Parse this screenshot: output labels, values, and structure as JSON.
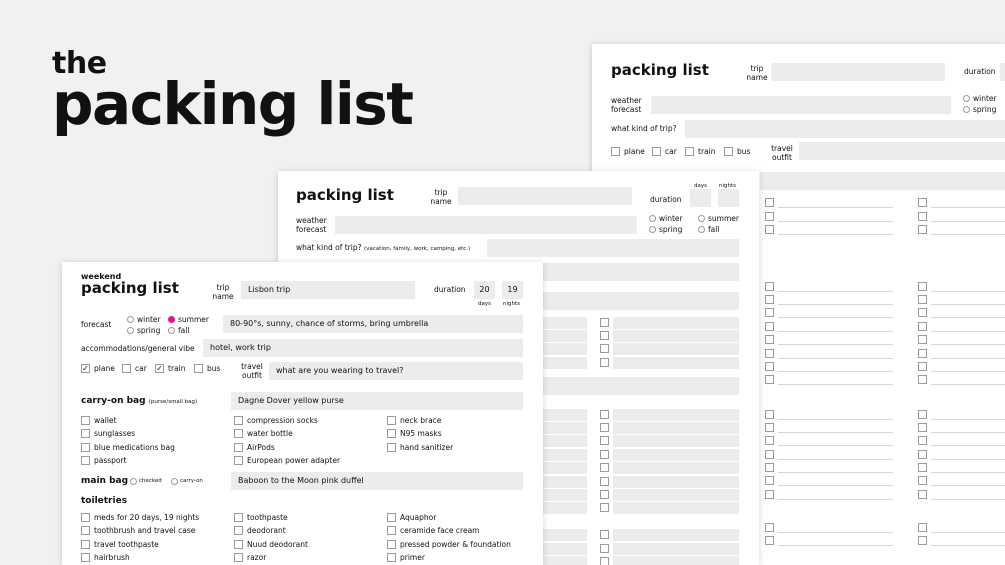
{
  "hero": {
    "top": "the",
    "title": "packing list"
  },
  "back_sheet": {
    "title": "packing list",
    "trip_name_label": "trip name",
    "duration_label": "duration",
    "weather_label": "weather forecast",
    "seasons": [
      "winter",
      "spring"
    ],
    "trip_kind_label": "what kind of trip?",
    "transport": [
      "plane",
      "car",
      "train",
      "bus"
    ],
    "travel_outfit_label": "travel outfit"
  },
  "middle_sheet": {
    "title": "packing list",
    "trip_name_label": "trip name",
    "duration_label": "duration",
    "days_label": "days",
    "nights_label": "nights",
    "weather_label": "weather forecast",
    "seasons": [
      "winter",
      "summer",
      "spring",
      "fall"
    ],
    "trip_kind_label": "what kind of trip?",
    "trip_kind_hint": "(vacation, family, work, camping, etc.)"
  },
  "front_sheet": {
    "subtitle": "weekend",
    "title": "packing list",
    "trip_name_label": "trip name",
    "trip_name_value": "Lisbon trip",
    "duration_label": "duration",
    "days_value": "20",
    "nights_value": "19",
    "days_label": "days",
    "nights_label": "nights",
    "forecast_label": "forecast",
    "seasons": [
      {
        "label": "winter",
        "selected": false
      },
      {
        "label": "summer",
        "selected": true
      },
      {
        "label": "spring",
        "selected": false
      },
      {
        "label": "fall",
        "selected": false
      }
    ],
    "forecast_value": "80-90°s, sunny, chance of storms, bring umbrella",
    "vibe_label": "accommodations/general vibe",
    "vibe_value": "hotel, work trip",
    "transport": [
      {
        "label": "plane",
        "checked": true
      },
      {
        "label": "car",
        "checked": false
      },
      {
        "label": "train",
        "checked": true
      },
      {
        "label": "bus",
        "checked": false
      }
    ],
    "travel_outfit_label": "travel outfit",
    "travel_outfit_value": "what are you wearing to travel?",
    "carry_on_label": "carry-on bag",
    "carry_on_hint": "(purse/small bag)",
    "carry_on_value": "Dagne Dover yellow purse",
    "carry_on_items": [
      "wallet",
      "compression socks",
      "neck brace",
      "sunglasses",
      "water bottle",
      "N95 masks",
      "blue medications bag",
      "AirPods",
      "hand sanitizer",
      "passport",
      "European power adapter"
    ],
    "main_bag_label": "main bag",
    "main_bag_options": [
      "checked",
      "carry-on"
    ],
    "main_bag_value": "Baboon to the Moon pink duffel",
    "toiletries_label": "toiletries",
    "toiletries_items": [
      "meds for 20 days, 19 nights",
      "toothpaste",
      "Aquaphor",
      "toothbrush and travel case",
      "deodorant",
      "ceramide face cream",
      "travel toothpaste",
      "Nuud deodorant",
      "pressed powder & foundation",
      "hairbrush",
      "razor",
      "primer"
    ]
  },
  "colors": {
    "accent": "#e0168b",
    "field": "#ececec",
    "background": "#f1f1f1"
  }
}
